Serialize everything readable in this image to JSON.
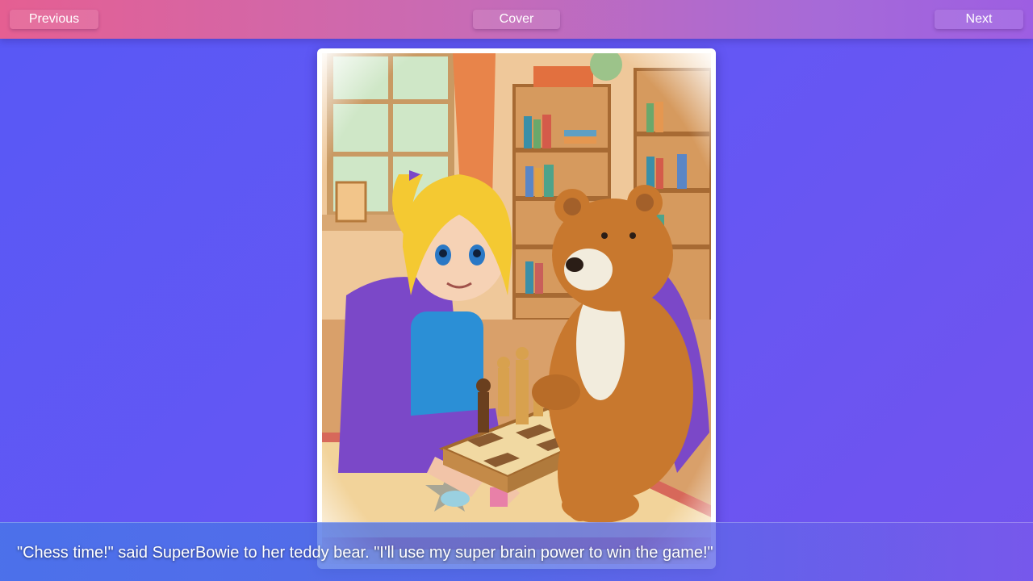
{
  "nav": {
    "previous_label": "Previous",
    "cover_label": "Cover",
    "next_label": "Next"
  },
  "page": {
    "caption": "\"Chess time!\" said SuperBowie to her teddy bear. \"I'll use my super brain power to win the game!\""
  },
  "colors": {
    "background": "#5f58f4",
    "topbar_left": "#e55f92",
    "topbar_right": "#9d5ee2",
    "cape_purple": "#7b48c8",
    "bear_brown": "#c8782e",
    "shirt_blue": "#2b8fd6",
    "hair_blonde": "#f4c932"
  }
}
